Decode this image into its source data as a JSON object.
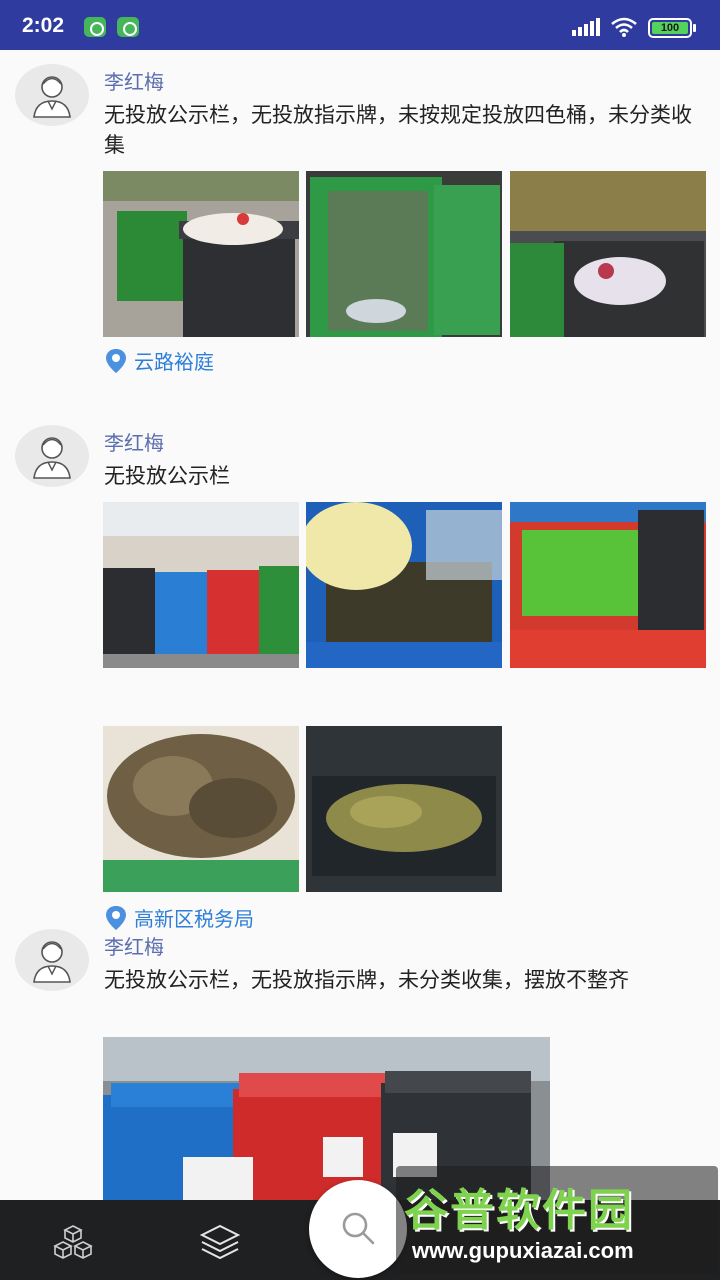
{
  "status_bar": {
    "time": "2:02",
    "battery": "100",
    "icons": [
      "app-notification-icon",
      "app-notification-icon",
      "signal-icon",
      "wifi-icon",
      "battery-icon"
    ]
  },
  "posts": [
    {
      "author": "李红梅",
      "text": "无投放公示栏，无投放指示牌，未按规定投放四色桶，未分类收集",
      "location": "云路裕庭",
      "photo_count": 3
    },
    {
      "author": "李红梅",
      "text": "无投放公示栏",
      "location": "高新区税务局",
      "photo_count": 5
    },
    {
      "author": "李红梅",
      "text": "无投放公示栏，无投放指示牌，未分类收集，摆放不整齐",
      "photo_count": 1
    }
  ],
  "bottom_nav": {
    "items": [
      "cubes-icon",
      "layers-icon",
      "search-icon"
    ]
  },
  "watermark": {
    "title": "谷普软件园",
    "url": "www.gupuxiazai.com"
  },
  "colors": {
    "status_bar": "#2f3b9e",
    "author_name": "#5b6eae",
    "location_text": "#2f7fd8",
    "bottom_nav": "#1f2022"
  }
}
